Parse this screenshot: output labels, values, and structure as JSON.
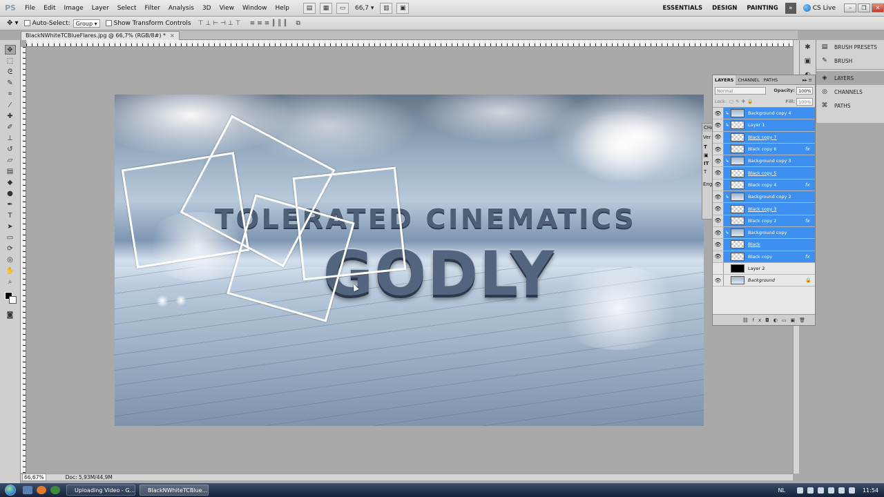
{
  "app": {
    "logo": "PS",
    "menu": [
      "File",
      "Edit",
      "Image",
      "Layer",
      "Select",
      "Filter",
      "Analysis",
      "3D",
      "View",
      "Window",
      "Help"
    ],
    "zoom_value": "66,7",
    "workspaces": [
      "ESSENTIALS",
      "DESIGN",
      "PAINTING"
    ],
    "more_label": "»",
    "cs_live": "CS Live"
  },
  "options": {
    "auto_select_label": "Auto-Select:",
    "auto_select_value": "Group",
    "show_transform_label": "Show Transform Controls"
  },
  "document": {
    "tab_title": "BlackNWhiteTCBlueFlares.jpg @ 66,7% (RGB/8#) *",
    "tab_close": "×",
    "headline_small": "TOLERATED CINEMATICS",
    "headline_big": "GODLY"
  },
  "status": {
    "zoom": "66,67%",
    "doc_info": "Doc: 5,93M/44,9M"
  },
  "dock": {
    "items": [
      {
        "label": "BRUSH PRESETS",
        "icon": "brush-presets-icon"
      },
      {
        "label": "BRUSH",
        "icon": "brush-icon"
      },
      {
        "label": "LAYERS",
        "icon": "layers-icon"
      },
      {
        "label": "CHANNELS",
        "icon": "channels-icon"
      },
      {
        "label": "PATHS",
        "icon": "paths-icon"
      }
    ]
  },
  "char_panel": {
    "tab": "CHA",
    "field": "Ver",
    "lang": "Eng"
  },
  "layers_panel": {
    "tabs": [
      "LAYERS",
      "CHANNEL",
      "PATHS"
    ],
    "blend_mode": "Normal",
    "opacity_label": "Opacity:",
    "opacity_value": "100%",
    "lock_label": "Lock:",
    "fill_label": "Fill:",
    "fill_value": "100%",
    "layers": [
      {
        "name": "Background copy 4",
        "selected": true,
        "clip": true,
        "thumb": "image",
        "fx": false,
        "underline": false
      },
      {
        "name": "Layer 1",
        "selected": true,
        "clip": true,
        "thumb": "check",
        "fx": false,
        "underline": false
      },
      {
        "name": "Black copy 7",
        "selected": true,
        "clip": false,
        "thumb": "check",
        "fx": false,
        "underline": true
      },
      {
        "name": "Black copy 6",
        "selected": true,
        "clip": false,
        "thumb": "check",
        "fx": true,
        "underline": false
      },
      {
        "name": "Background copy 3",
        "selected": true,
        "clip": true,
        "thumb": "image",
        "fx": false,
        "underline": false
      },
      {
        "name": "Black copy 5",
        "selected": true,
        "clip": false,
        "thumb": "check",
        "fx": false,
        "underline": true
      },
      {
        "name": "Black copy 4",
        "selected": true,
        "clip": false,
        "thumb": "check",
        "fx": true,
        "underline": false
      },
      {
        "name": "Background copy 2",
        "selected": true,
        "clip": true,
        "thumb": "image",
        "fx": false,
        "underline": false
      },
      {
        "name": "Black copy 3",
        "selected": true,
        "clip": false,
        "thumb": "check",
        "fx": false,
        "underline": true
      },
      {
        "name": "Black copy 2",
        "selected": true,
        "clip": false,
        "thumb": "check",
        "fx": true,
        "underline": false
      },
      {
        "name": "Background copy",
        "selected": true,
        "clip": true,
        "thumb": "image",
        "fx": false,
        "underline": false
      },
      {
        "name": "Black",
        "selected": true,
        "clip": false,
        "thumb": "check",
        "fx": false,
        "underline": true
      },
      {
        "name": "Black copy",
        "selected": true,
        "clip": false,
        "thumb": "check",
        "fx": true,
        "underline": false
      },
      {
        "name": "Layer 2",
        "selected": false,
        "clip": false,
        "thumb": "black",
        "fx": false,
        "underline": false,
        "hidden": true
      },
      {
        "name": "Background",
        "selected": false,
        "clip": false,
        "thumb": "image",
        "fx": false,
        "underline": false,
        "italic": true,
        "locked": true
      }
    ]
  },
  "taskbar": {
    "tasks": [
      {
        "label": "Uploading Video - G...",
        "icon_color": "#e0b84a"
      },
      {
        "label": "BlackNWhiteTCBlue...",
        "icon_color": "#2f6bd1"
      }
    ],
    "language": "NL",
    "clock": "11:54"
  },
  "colors": {
    "selection_blue": "#3d8ff0",
    "taskbar": "#17233a"
  }
}
